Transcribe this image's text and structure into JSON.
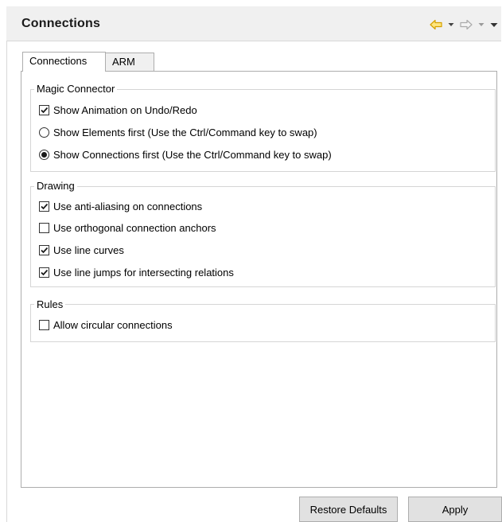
{
  "header": {
    "title": "Connections",
    "back_icon": "back-arrow-icon",
    "forward_icon": "forward-arrow-icon",
    "menu_icon": "view-menu-icon"
  },
  "tabs": [
    {
      "label": "Connections",
      "selected": true
    },
    {
      "label": "ARM",
      "selected": false
    }
  ],
  "groups": {
    "magic_connector": {
      "label": "Magic Connector",
      "items": [
        {
          "label": "Show Animation on Undo/Redo",
          "type": "checkbox",
          "checked": true
        },
        {
          "label": "Show Elements first (Use the Ctrl/Command key to swap)",
          "type": "radio",
          "checked": false
        },
        {
          "label": "Show Connections first (Use the Ctrl/Command key to swap)",
          "type": "radio",
          "checked": true
        }
      ]
    },
    "drawing": {
      "label": "Drawing",
      "items": [
        {
          "label": "Use anti-aliasing on connections",
          "type": "checkbox",
          "checked": true
        },
        {
          "label": "Use orthogonal connection anchors",
          "type": "checkbox",
          "checked": false
        },
        {
          "label": "Use line curves",
          "type": "checkbox",
          "checked": true
        },
        {
          "label": "Use line jumps for intersecting relations",
          "type": "checkbox",
          "checked": true
        }
      ]
    },
    "rules": {
      "label": "Rules",
      "items": [
        {
          "label": "Allow circular connections",
          "type": "checkbox",
          "checked": false
        }
      ]
    }
  },
  "buttons": {
    "restore_defaults": "Restore Defaults",
    "apply": "Apply"
  },
  "colors": {
    "header_bg": "#f0f0f0",
    "back_arrow": "#e8b800",
    "button_bg": "#e1e1e1"
  }
}
